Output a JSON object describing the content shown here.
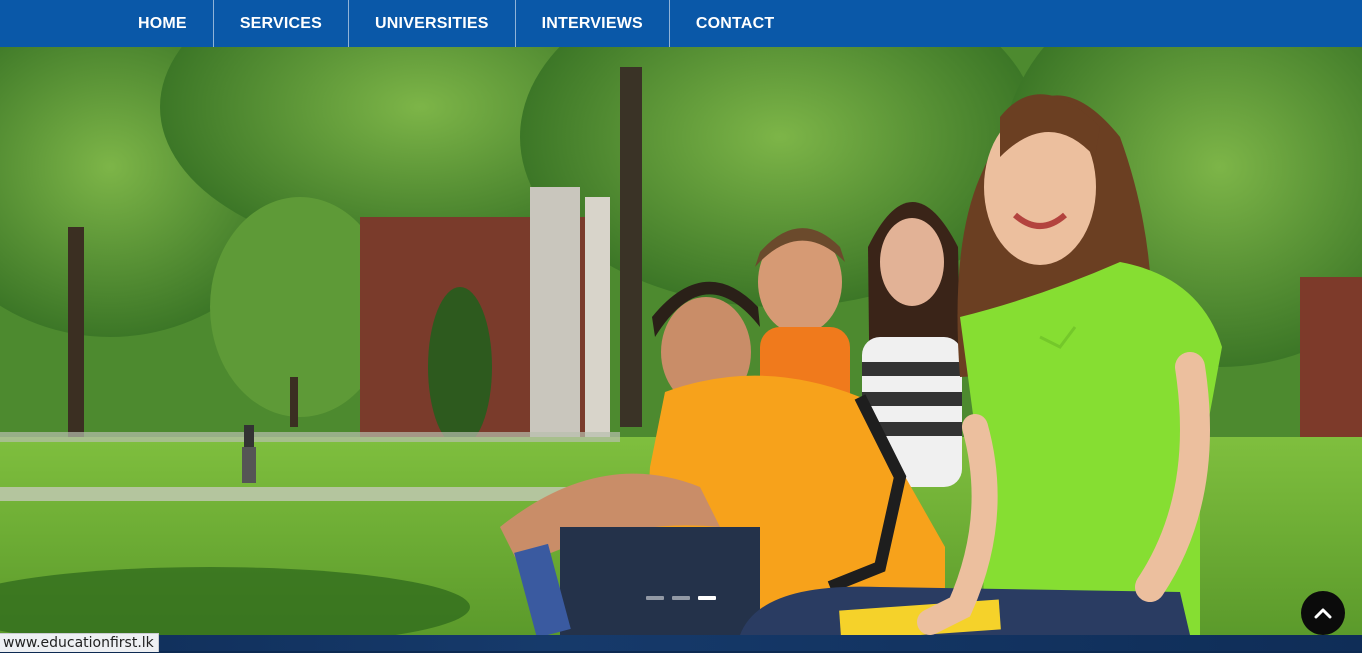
{
  "nav": {
    "items": [
      {
        "label": "HOME"
      },
      {
        "label": "SERVICES"
      },
      {
        "label": "UNIVERSITIES"
      },
      {
        "label": "INTERVIEWS"
      },
      {
        "label": "CONTACT"
      }
    ]
  },
  "slider": {
    "slide_count": 3,
    "active_slide": 3
  },
  "status_bar": {
    "url": "www.educationfirst.lk"
  },
  "back_to_top": {
    "icon": "chevron-up-icon"
  },
  "colors": {
    "nav_bg": "#0a58a8",
    "nav_text": "#ffffff",
    "footer_strip": "#0f2d57",
    "back_to_top_bg": "#0b0b0b"
  }
}
